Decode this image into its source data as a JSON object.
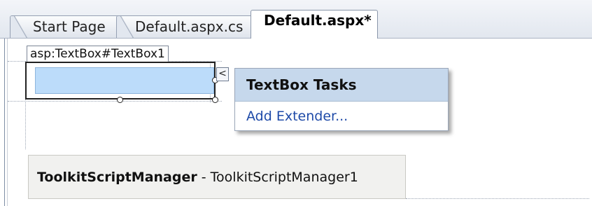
{
  "tabs": {
    "start_page": "Start Page",
    "default_cs": "Default.aspx.cs",
    "default_aspx": "Default.aspx*"
  },
  "designer": {
    "control_tag": "asp:TextBox#TextBox1",
    "smart_tag_glyph": "<",
    "tasks_panel": {
      "title": "TextBox Tasks",
      "add_extender": "Add Extender..."
    },
    "script_manager": {
      "type_name": "ToolkitScriptManager",
      "separator": " - ",
      "instance_name": "ToolkitScriptManager1"
    }
  },
  "colors": {
    "selected_textbox": "#bcdcfa",
    "tasks_header": "#c6d8ec",
    "link": "#1e4aa8"
  }
}
